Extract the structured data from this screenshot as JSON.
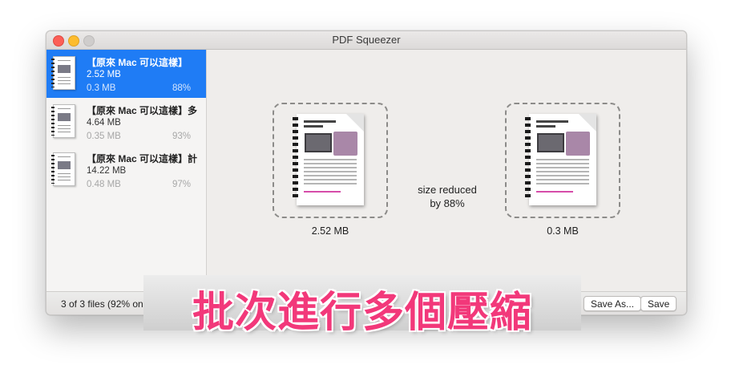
{
  "window": {
    "title": "PDF Squeezer"
  },
  "files": [
    {
      "name": "【原來 Mac 可以這樣】",
      "original_size": "2.52 MB",
      "compressed_size": "0.3 MB",
      "reduction": "88%",
      "selected": true
    },
    {
      "name": "【原來 Mac 可以這樣】多",
      "original_size": "4.64 MB",
      "compressed_size": "0.35 MB",
      "reduction": "93%",
      "selected": false
    },
    {
      "name": "【原來 Mac 可以這樣】計",
      "original_size": "14.22 MB",
      "compressed_size": "0.48 MB",
      "reduction": "97%",
      "selected": false
    }
  ],
  "preview": {
    "original_size": "2.52 MB",
    "compressed_size": "0.3 MB",
    "reduced_line1": "size reduced",
    "reduced_line2": "by 88%"
  },
  "statusbar": {
    "status": "3 of 3 files (92% on",
    "save_as_label": "Save As...",
    "save_label": "Save"
  },
  "overlay": {
    "caption": "批次進行多個壓縮"
  },
  "colors": {
    "selection": "#1f7cf5",
    "caption": "#f2387a"
  }
}
